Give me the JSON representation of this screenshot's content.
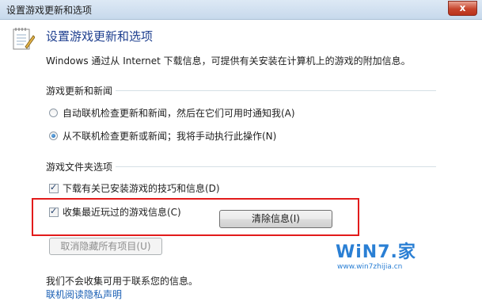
{
  "window": {
    "title": "设置游戏更新和选项",
    "close_glyph": "x"
  },
  "header": {
    "title": "设置游戏更新和选项",
    "description": "Windows 通过从 Internet 下载信息，可提供有关安装在计算机上的游戏的附加信息。"
  },
  "section_updates": {
    "label": "游戏更新和新闻",
    "options": [
      {
        "label": "自动联机检查更新和新闻，然后在它们可用时通知我(A)",
        "checked": false
      },
      {
        "label": "从不联机检查更新或新闻；我将手动执行此操作(N)",
        "checked": true
      }
    ]
  },
  "section_folder": {
    "label": "游戏文件夹选项",
    "checkboxes": [
      {
        "label": "下载有关已安装游戏的技巧和信息(D)",
        "checked": true
      },
      {
        "label": "收集最近玩过的游戏信息(C)",
        "checked": true
      }
    ],
    "clear_button": "清除信息(I)",
    "unhide_button": "取消隐藏所有项目(U)"
  },
  "footer": {
    "privacy_note": "我们不会收集可用于联系您的信息。",
    "privacy_link": "联机阅读隐私声明"
  },
  "watermark": {
    "brand": "WiN7.家",
    "url": "www.win7zhijia.cn"
  },
  "colors": {
    "accent": "#1e3f8f",
    "link": "#1a5fb4",
    "highlight": "#e21b1b"
  }
}
